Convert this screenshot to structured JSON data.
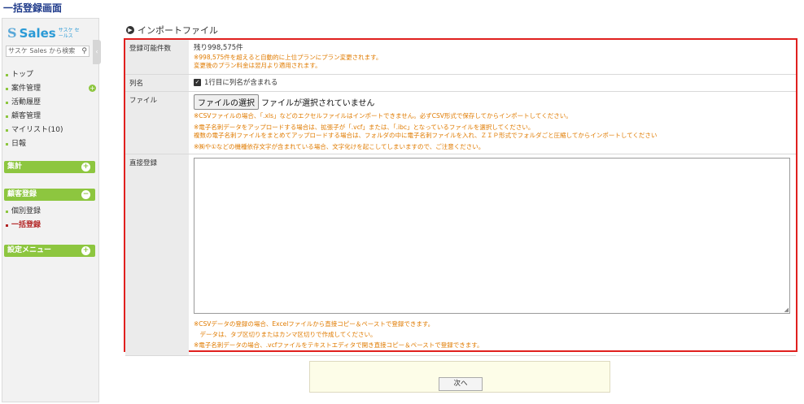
{
  "page_title": "一括登録画面",
  "sidebar": {
    "logo_main": "Sales",
    "logo_small": "サスケ セールス",
    "search_placeholder": "サスケ Sales から検索",
    "nav_items": [
      {
        "label": "トップ"
      },
      {
        "label": "案件管理"
      },
      {
        "label": "活動履歴"
      },
      {
        "label": "顧客管理"
      },
      {
        "label": "マイリスト(10)"
      },
      {
        "label": "日報"
      }
    ],
    "sections": [
      {
        "label": "集計",
        "icon": "plus-icon"
      },
      {
        "label": "顧客登録",
        "icon": "minus-icon"
      },
      {
        "label": "設定メニュー",
        "icon": "plus-icon"
      }
    ],
    "sub_items": [
      {
        "label": "個別登録",
        "active": false
      },
      {
        "label": "一括登録",
        "active": true
      }
    ]
  },
  "main": {
    "heading": "インポートファイル",
    "rows": {
      "capacity": {
        "label": "登録可能件数",
        "value": "残り998,575件",
        "note1": "※998,575件を超えると自動的に上位プランにプラン変更されます。",
        "note2": "変更後のプラン料金は翌月より適用されます。"
      },
      "header_row": {
        "label": "列名",
        "checkbox_label": "1行目に列名が含まれる",
        "checked": true
      },
      "file": {
        "label": "ファイル",
        "button": "ファイルの選択",
        "status": "ファイルが選択されていません",
        "note1": "※CSVファイルの場合、「.xls」などのエクセルファイルはインポートできません。必ずCSV形式で保存してからインポートしてください。",
        "note2": "※電子名刺データをアップロードする場合は、拡張子が「.vcf」または、「.ibc」となっているファイルを選択してください。",
        "note3": "複数の電子名刺ファイルをまとめてアップロードする場合は、フォルダの中に電子名刺ファイルを入れ、ＺＩＰ形式でフォルダごと圧縮してからインポートしてください",
        "note4": "※㈱や①などの機種依存文字が含まれている場合、文字化けを起こしてしまいますので、ご注意ください。"
      },
      "direct": {
        "label": "直接登録",
        "note1": "※CSVデータの登録の場合、Excelファイルから直接コピー＆ペーストで登録できます。",
        "note2": "　データは、タブ区切りまたはカンマ区切りで作成してください。",
        "note3": "※電子名刺データの場合、.vcfファイルをテキストエディタで開き直接コピー＆ペーストで登録できます。"
      }
    },
    "next_button": "次へ"
  },
  "colors": {
    "accent_green": "#8dc63f",
    "highlight_red": "#e0201e",
    "note_orange": "#e07b00",
    "title_blue": "#1e3a8a"
  }
}
